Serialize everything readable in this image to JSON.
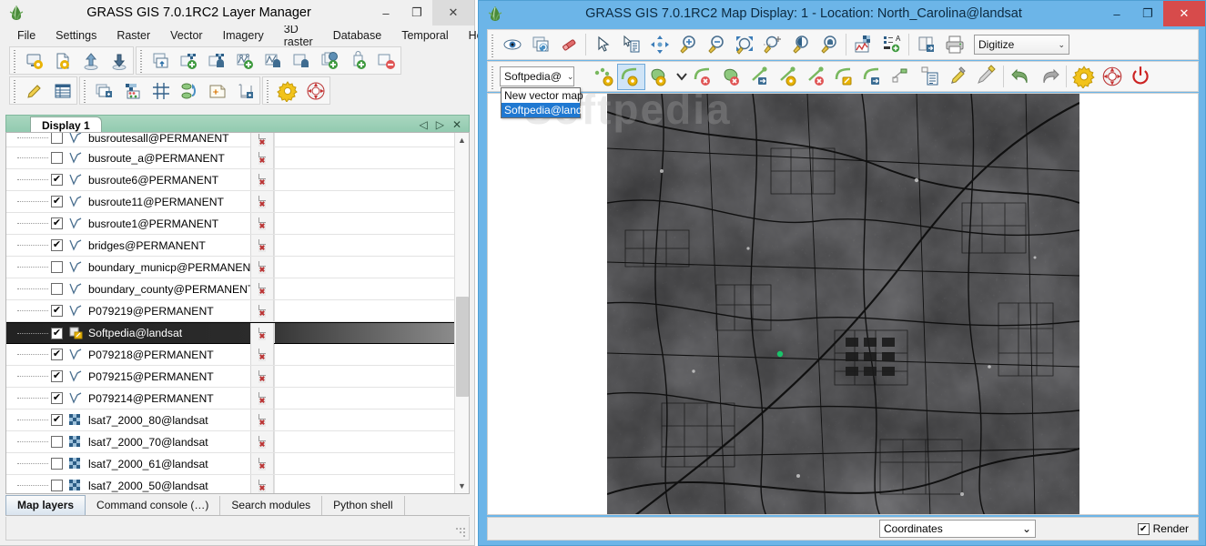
{
  "layer_manager": {
    "title": "GRASS GIS 7.0.1RC2 Layer Manager",
    "window_icon": "grass-logo-icon",
    "window_buttons": {
      "minimize": "–",
      "maximize": "❐",
      "close": "✕"
    },
    "menu": [
      {
        "label": "File"
      },
      {
        "label": "Settings"
      },
      {
        "label": "Raster"
      },
      {
        "label": "Vector"
      },
      {
        "label": "Imagery"
      },
      {
        "label": "3D raster"
      },
      {
        "label": "Database"
      },
      {
        "label": "Temporal"
      },
      {
        "label": "Help"
      }
    ],
    "toolbar_row1": [
      {
        "name": "start-new-map-display-icon"
      },
      {
        "name": "create-new-workspace-icon"
      },
      {
        "name": "open-workspace-icon"
      },
      {
        "name": "save-workspace-icon"
      },
      {
        "name": "import-raster-data-icon"
      },
      {
        "name": "add-raster-map-layer-icon"
      },
      {
        "name": "add-various-raster-layers-icon"
      },
      {
        "name": "add-vector-map-layer-icon"
      },
      {
        "name": "add-various-vector-layers-icon"
      },
      {
        "name": "add-command-layer-icon"
      },
      {
        "name": "add-group-icon"
      },
      {
        "name": "add-web-service-layer-icon"
      },
      {
        "name": "remove-selected-layer-icon"
      }
    ],
    "toolbar_row2": [
      {
        "name": "edit-raster-maps-icon"
      },
      {
        "name": "show-attribute-table-icon"
      },
      {
        "name": "add-layer-to-display-icon"
      },
      {
        "name": "raster-map-calculator-icon"
      },
      {
        "name": "georectifier-icon"
      },
      {
        "name": "graphical-modeler-icon"
      },
      {
        "name": "cartographic-composer-icon"
      },
      {
        "name": "launch-script-icon"
      },
      {
        "name": "settings-gear-icon"
      },
      {
        "name": "help-lifebuoy-icon"
      }
    ],
    "display_tab": {
      "label": "Display 1",
      "nav_prev": "◁",
      "nav_next": "▷",
      "close": "✕"
    },
    "layers": [
      {
        "label": "busroutesall@PERMANENT",
        "checked": false,
        "type": "vector",
        "partial": true
      },
      {
        "label": "busroute_a@PERMANENT",
        "checked": false,
        "type": "vector"
      },
      {
        "label": "busroute6@PERMANENT",
        "checked": true,
        "type": "vector"
      },
      {
        "label": "busroute11@PERMANENT",
        "checked": true,
        "type": "vector"
      },
      {
        "label": "busroute1@PERMANENT",
        "checked": true,
        "type": "vector"
      },
      {
        "label": "bridges@PERMANENT",
        "checked": true,
        "type": "vector"
      },
      {
        "label": "boundary_municp@PERMANENT",
        "checked": false,
        "type": "vector"
      },
      {
        "label": "boundary_county@PERMANENT",
        "checked": false,
        "type": "vector"
      },
      {
        "label": "P079219@PERMANENT",
        "checked": true,
        "type": "vector"
      },
      {
        "label": "Softpedia@landsat",
        "checked": true,
        "type": "vector-edit",
        "selected": true
      },
      {
        "label": "P079218@PERMANENT",
        "checked": true,
        "type": "vector"
      },
      {
        "label": "P079215@PERMANENT",
        "checked": true,
        "type": "vector"
      },
      {
        "label": "P079214@PERMANENT",
        "checked": true,
        "type": "vector"
      },
      {
        "label": "lsat7_2000_80@landsat",
        "checked": true,
        "type": "raster"
      },
      {
        "label": "lsat7_2000_70@landsat",
        "checked": false,
        "type": "raster"
      },
      {
        "label": "lsat7_2000_61@landsat",
        "checked": false,
        "type": "raster"
      },
      {
        "label": "lsat7_2000_50@landsat",
        "checked": false,
        "type": "raster"
      }
    ],
    "bottom_tabs": [
      {
        "label": "Map layers",
        "active": true
      },
      {
        "label": "Command console (…)",
        "active": false
      },
      {
        "label": "Search modules",
        "active": false
      },
      {
        "label": "Python shell",
        "active": false
      }
    ]
  },
  "map_display": {
    "title": "GRASS GIS 7.0.1RC2 Map Display: 1  - Location: North_Carolina@landsat",
    "window_icon": "grass-logo-icon",
    "window_buttons": {
      "minimize": "–",
      "maximize": "❐",
      "close": "✕"
    },
    "toolbar": [
      {
        "name": "display-map-eye-icon"
      },
      {
        "name": "render-map-icon"
      },
      {
        "name": "erase-display-icon"
      },
      {
        "name": "pointer-arrow-icon"
      },
      {
        "name": "query-raster-vector-icon"
      },
      {
        "name": "pan-move-icon"
      },
      {
        "name": "zoom-in-icon"
      },
      {
        "name": "zoom-out-icon"
      },
      {
        "name": "zoom-to-selected-map-icon"
      },
      {
        "name": "zoom-to-extent-icon"
      },
      {
        "name": "zoom-back-icon"
      },
      {
        "name": "zoom-options-icon"
      },
      {
        "name": "analyze-map-profile-icon"
      },
      {
        "name": "add-map-elements-icon"
      },
      {
        "name": "save-display-to-file-icon"
      },
      {
        "name": "print-map-icon"
      }
    ],
    "mode_combo": {
      "value": "Digitize",
      "caret": "⌄"
    },
    "digitize_toolbar": {
      "layer_combo": {
        "value": "Softpedia@",
        "caret": "⌄"
      },
      "dropdown_open": true,
      "dropdown_options": [
        {
          "label": "New vector map",
          "selected": false
        },
        {
          "label": "Softpedia@land",
          "selected": true
        }
      ],
      "buttons": [
        {
          "name": "digitize-new-point-icon",
          "active": false
        },
        {
          "name": "digitize-new-line-icon",
          "active": true
        },
        {
          "name": "digitize-new-boundary-icon",
          "active": false
        },
        {
          "name": "digitize-more-tools-chevron-icon",
          "active": false
        },
        {
          "name": "delete-line-icon",
          "active": false
        },
        {
          "name": "delete-area-icon",
          "active": false
        },
        {
          "name": "move-vertex-icon",
          "active": false
        },
        {
          "name": "add-vertex-icon",
          "active": false
        },
        {
          "name": "remove-vertex-icon",
          "active": false
        },
        {
          "name": "edit-line-icon",
          "active": false
        },
        {
          "name": "edit-line-segment-icon",
          "active": false
        },
        {
          "name": "move-feature-icon",
          "active": false
        },
        {
          "name": "copy-categories-icon",
          "active": false
        },
        {
          "name": "display-categories-icon",
          "active": false
        },
        {
          "name": "digitization-settings-icon",
          "active": false
        },
        {
          "name": "undo-icon",
          "active": false
        },
        {
          "name": "redo-icon",
          "active": false
        },
        {
          "name": "settings-gear-icon",
          "active": false
        },
        {
          "name": "help-lifebuoy-icon",
          "active": false
        },
        {
          "name": "quit-digitizer-power-icon",
          "active": false
        }
      ]
    },
    "status_bar": {
      "coordinates_combo": {
        "value": "Coordinates",
        "caret": "⌄"
      },
      "render_label": "Render",
      "render_checked": true
    }
  },
  "colors": {
    "titlebar_active": "#6cb5e8",
    "close_button": "#d74b4b",
    "tab_header_green": "#8fc9ae",
    "selection_blue": "#1f78d1",
    "selected_row_dark": "#222222",
    "toolbar_bg": "#f7f7f7",
    "window_bg": "#f0f0f0"
  }
}
